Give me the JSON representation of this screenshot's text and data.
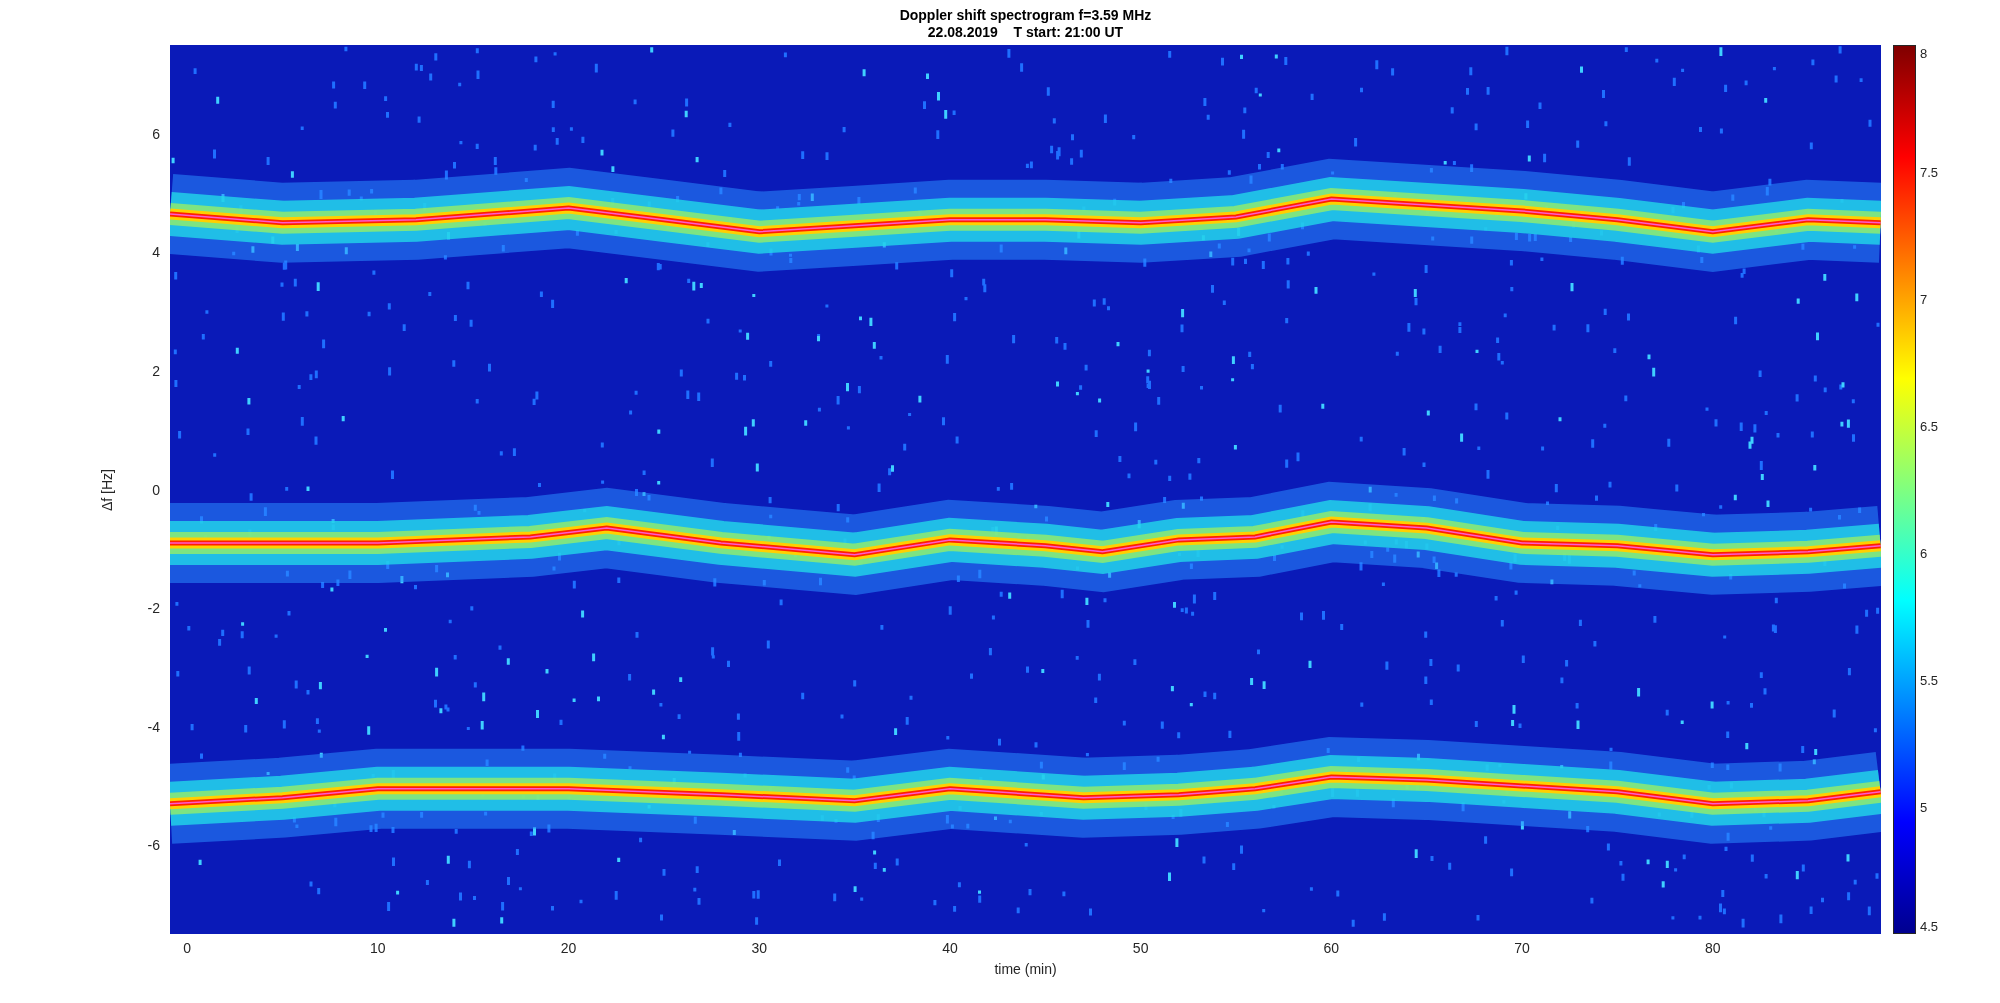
{
  "figure": {
    "title": "Doppler shift spectrogram f=3.59 MHz",
    "subtitle": "22.08.2019    T start: 21:00 UT",
    "xlabel": "time (min)",
    "ylabel": "Δf [Hz]",
    "xticks": [
      "0",
      "10",
      "20",
      "30",
      "40",
      "50",
      "60",
      "70",
      "80"
    ],
    "yticks": [
      "6",
      "4",
      "2",
      "0",
      "-2",
      "-4",
      "-6"
    ]
  },
  "colorbar": {
    "ticks": [
      "8",
      "7.5",
      "7",
      "6.5",
      "6",
      "5.5",
      "5",
      "4.5"
    ]
  }
}
